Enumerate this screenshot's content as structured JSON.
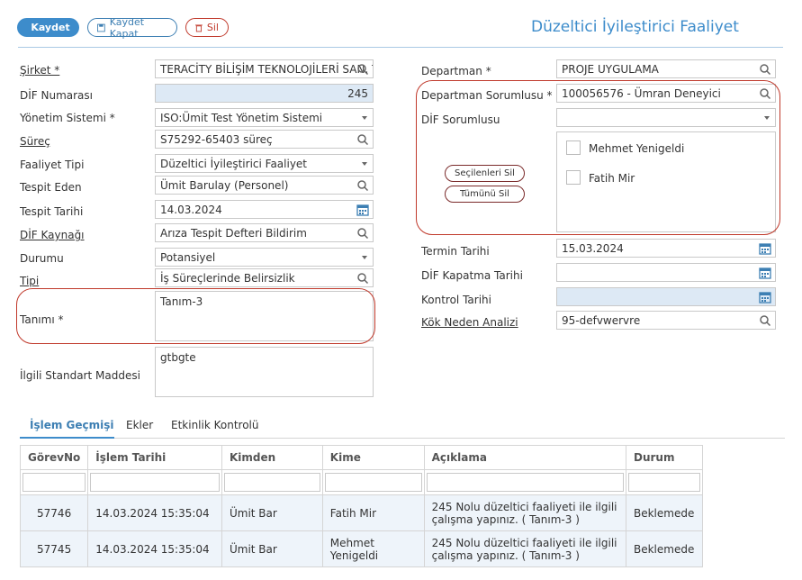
{
  "toolbar": {
    "save_label": "Kaydet",
    "save_close_label": "Kaydet Kapat",
    "delete_label": "Sil"
  },
  "page_title": "Düzeltici İyileştirici Faaliyet",
  "left_form": {
    "sirket": {
      "label": "Şirket *",
      "value": "TERACİTY BİLİŞİM TEKNOLOJİLERİ SAN. TİC."
    },
    "dif_no": {
      "label": "DİF Numarası",
      "value": "245"
    },
    "yonetim": {
      "label": "Yönetim Sistemi *",
      "value": "ISO:Ümit Test Yönetim Sistemi"
    },
    "surec": {
      "label": "Süreç",
      "value": "S75292-65403 süreç"
    },
    "faaliyet_tipi": {
      "label": "Faaliyet Tipi",
      "value": "Düzeltici İyileştirici Faaliyet"
    },
    "tespit_eden": {
      "label": "Tespit Eden",
      "value": "Ümit Barulay (Personel)"
    },
    "tespit_tarihi": {
      "label": "Tespit Tarihi",
      "value": "14.03.2024"
    },
    "dif_kaynagi": {
      "label": "DİF Kaynağı",
      "value": "Arıza Tespit Defteri Bildirim"
    },
    "durumu": {
      "label": "Durumu",
      "value": "Potansiyel"
    },
    "tipi": {
      "label": "Tipi",
      "value": "İş Süreçlerinde Belirsizlik"
    },
    "tanimi": {
      "label": "Tanımı *",
      "value": "Tanım-3"
    },
    "ilgili": {
      "label": "İlgili Standart Maddesi",
      "value": "gtbgte"
    }
  },
  "right_form": {
    "departman": {
      "label": "Departman *",
      "value": "PROJE UYGULAMA"
    },
    "dep_sorumlu": {
      "label": "Departman Sorumlusu *",
      "value": "100056576 - Ümran Deneyici"
    },
    "dif_sorumlu": {
      "label": "DİF Sorumlusu",
      "value": ""
    },
    "selected_delete_label": "Seçilenleri Sil",
    "all_delete_label": "Tümünü Sil",
    "people": [
      "Mehmet Yenigeldi",
      "Fatih Mir"
    ],
    "termin": {
      "label": "Termin Tarihi",
      "value": "15.03.2024"
    },
    "kapatma": {
      "label": "DİF Kapatma Tarihi",
      "value": ""
    },
    "kontrol": {
      "label": "Kontrol Tarihi",
      "value": ""
    },
    "kok_neden": {
      "label": "Kök Neden Analizi",
      "value": "95-defvwervre"
    }
  },
  "tabs": [
    "İşlem Geçmişi",
    "Ekler",
    "Etkinlik Kontrolü"
  ],
  "table": {
    "headers": [
      "GörevNo",
      "İşlem Tarihi",
      "Kimden",
      "Kime",
      "Açıklama",
      "Durum"
    ],
    "rows": [
      [
        "57746",
        "14.03.2024 15:35:04",
        "Ümit Bar",
        "Fatih Mir",
        "245 Nolu düzeltici faaliyeti ile ilgili çalışma yapınız. ( Tanım-3 )",
        "Beklemede"
      ],
      [
        "57745",
        "14.03.2024 15:35:04",
        "Ümit Bar",
        "Mehmet Yenigeldi",
        "245 Nolu düzeltici faaliyeti ile ilgili çalışma yapınız. ( Tanım-3 )",
        "Beklemede"
      ]
    ]
  }
}
